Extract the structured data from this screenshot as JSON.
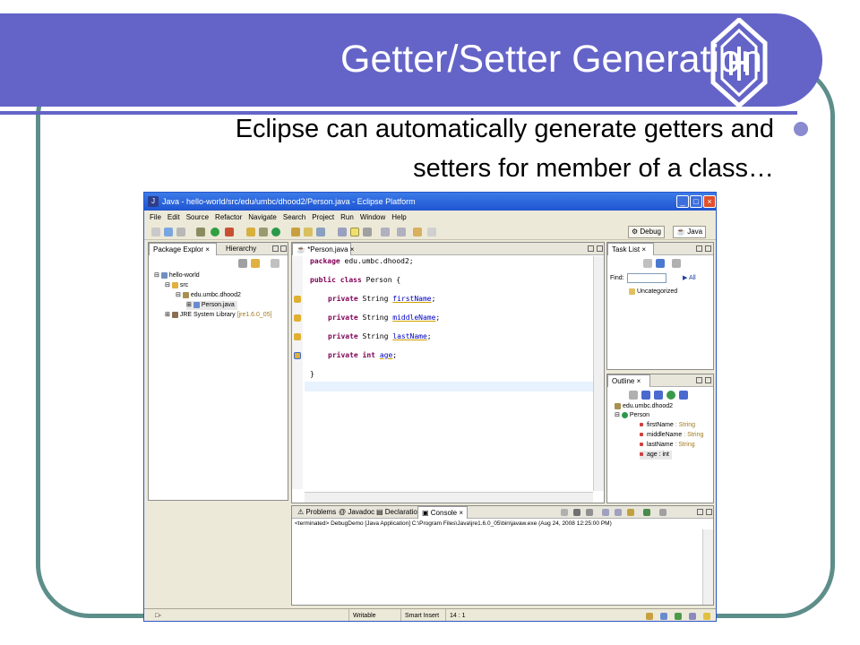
{
  "slide": {
    "title": "Getter/Setter Generation",
    "bullet_line1": "Eclipse can automatically generate getters and",
    "bullet_line2": "setters for member of a class…",
    "colors": {
      "title_band": "#6464c8",
      "frame": "#5d8e8a"
    }
  },
  "window": {
    "title": "Java - hello-world/src/edu/umbc/dhood2/Person.java - Eclipse Platform",
    "menu": [
      "File",
      "Edit",
      "Source",
      "Refactor",
      "Navigate",
      "Search",
      "Project",
      "Run",
      "Window",
      "Help"
    ],
    "perspectives": {
      "debug": "Debug",
      "java": "Java"
    }
  },
  "package_explorer": {
    "tabs": [
      "Package Explor",
      "Hierarchy"
    ],
    "tree": {
      "project": "hello-world",
      "src": "src",
      "package": "edu.umbc.dhood2",
      "file": "Person.java",
      "jre": "JRE System Library",
      "jre_version": "[jre1.6.0_05]"
    }
  },
  "editor": {
    "tab": "*Person.java",
    "lines": {
      "l1_kw": "package",
      "l1_rest": " edu.umbc.dhood2;",
      "l2_kw1": "public",
      "l2_kw2": " class",
      "l2_rest": " Person {",
      "l3_kw": "private",
      "l3_type": " String ",
      "l3_field": "firstName",
      "l3_end": ";",
      "l4_kw": "private",
      "l4_type": " String ",
      "l4_field": "middleName",
      "l4_end": ";",
      "l5_kw": "private",
      "l5_type": " String ",
      "l5_field": "lastName",
      "l5_end": ";",
      "l6_kw": "private",
      "l6_type": " int ",
      "l6_field": "age",
      "l6_end": ";",
      "l7": "}"
    }
  },
  "task_list": {
    "tab": "Task List",
    "find_label": "Find:",
    "all_label": "All",
    "category": "Uncategorized"
  },
  "outline": {
    "tab": "Outline",
    "package": "edu.umbc.dhood2",
    "class": "Person",
    "members": [
      {
        "name": "firstName",
        "type": " : String"
      },
      {
        "name": "middleName",
        "type": " : String"
      },
      {
        "name": "lastName",
        "type": " : String"
      },
      {
        "name": "age",
        "type": " : int"
      }
    ]
  },
  "bottom": {
    "tabs": [
      "Problems",
      "Javadoc",
      "Declaration",
      "Console"
    ],
    "console_line": "<terminated> DebugDemo [Java Application] C:\\Program Files\\Java\\jre1.6.0_05\\bin\\javaw.exe (Aug 24, 2008 12:25:00 PM)"
  },
  "status": {
    "writable": "Writable",
    "insert_mode": "Smart Insert",
    "position": "14 : 1"
  }
}
